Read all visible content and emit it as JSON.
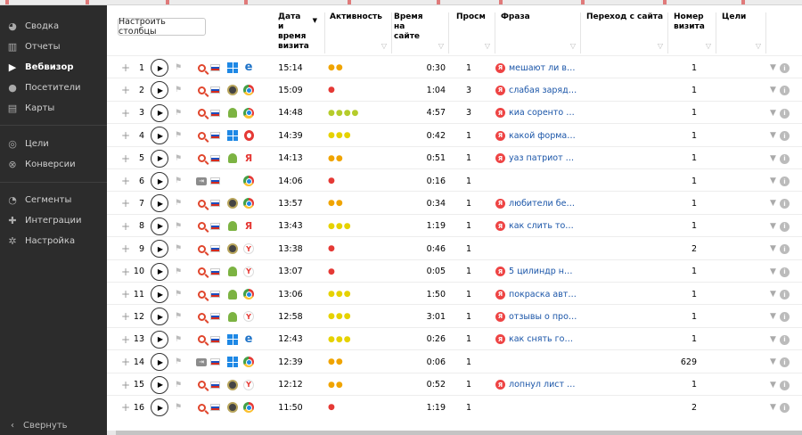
{
  "sidebar": {
    "items": [
      {
        "label": "Сводка",
        "icon": "dashboard-icon",
        "active": false
      },
      {
        "label": "Отчеты",
        "icon": "reports-icon",
        "active": false
      },
      {
        "label": "Вебвизор",
        "icon": "play-icon",
        "active": true
      },
      {
        "label": "Посетители",
        "icon": "user-icon",
        "active": false
      },
      {
        "label": "Карты",
        "icon": "map-icon",
        "active": false
      },
      {
        "label": "Цели",
        "icon": "target-icon",
        "active": false
      },
      {
        "label": "Конверсии",
        "icon": "conversion-icon",
        "active": false
      },
      {
        "label": "Сегменты",
        "icon": "pie-icon",
        "active": false
      },
      {
        "label": "Интеграции",
        "icon": "puzzle-icon",
        "active": false
      },
      {
        "label": "Настройка",
        "icon": "gear-icon",
        "active": false
      }
    ],
    "collapse_label": "Свернуть"
  },
  "toolbar": {
    "configure_columns": "Настроить столбцы"
  },
  "columns": {
    "datetime": "Дата и время визита",
    "activity": "Активность",
    "duration": "Время на сайте",
    "pageviews": "Просм",
    "phrase": "Фраза",
    "referrer": "Переход с сайта",
    "visit_number": "Номер визита",
    "goals": "Цели"
  },
  "colors": {
    "accent_red": "#e53935",
    "link": "#1a55a8",
    "sidebar_bg": "#2c2c2c"
  },
  "rows": [
    {
      "n": "1",
      "src": "search",
      "os": "windows",
      "browser": "edge",
      "time": "15:14",
      "activity": [
        {
          "c": "o",
          "k": 2
        }
      ],
      "duration": "0:30",
      "pv": "1",
      "phrase": "мешают ли вайтв...",
      "visit": "1"
    },
    {
      "n": "2",
      "src": "search",
      "os": "mac",
      "browser": "chrome",
      "time": "15:09",
      "activity": [
        {
          "c": "r",
          "k": 1
        }
      ],
      "duration": "1:04",
      "pv": "3",
      "phrase": "слабая зарядка у...",
      "visit": "1"
    },
    {
      "n": "3",
      "src": "search",
      "os": "android",
      "browser": "chrome",
      "time": "14:48",
      "activity": [
        {
          "c": "g",
          "k": 4
        }
      ],
      "duration": "4:57",
      "pv": "3",
      "phrase": "киа соренто 1 по...",
      "visit": "1"
    },
    {
      "n": "4",
      "src": "search",
      "os": "windows",
      "browser": "opera",
      "time": "14:39",
      "activity": [
        {
          "c": "y",
          "k": 3
        }
      ],
      "duration": "0:42",
      "pv": "1",
      "phrase": "какой формат фл...",
      "visit": "1"
    },
    {
      "n": "5",
      "src": "search",
      "os": "android",
      "browser": "yabrowser",
      "time": "14:13",
      "activity": [
        {
          "c": "o",
          "k": 2
        }
      ],
      "duration": "0:51",
      "pv": "1",
      "phrase": "уаз патриот пери...",
      "visit": "1"
    },
    {
      "n": "6",
      "src": "link",
      "os": "",
      "browser": "chrome",
      "time": "14:06",
      "activity": [
        {
          "c": "r",
          "k": 1
        }
      ],
      "duration": "0:16",
      "pv": "1",
      "phrase": "",
      "visit": "1"
    },
    {
      "n": "7",
      "src": "search",
      "os": "mac",
      "browser": "chrome",
      "time": "13:57",
      "activity": [
        {
          "c": "o",
          "k": 2
        }
      ],
      "duration": "0:34",
      "pv": "1",
      "phrase": "любители бездо...",
      "visit": "1"
    },
    {
      "n": "8",
      "src": "search",
      "os": "android",
      "browser": "yabrowser",
      "time": "13:43",
      "activity": [
        {
          "c": "y",
          "k": 3
        }
      ],
      "duration": "1:19",
      "pv": "1",
      "phrase": "как слить топлив...",
      "visit": "1"
    },
    {
      "n": "9",
      "src": "search",
      "os": "mac",
      "browser": "ya",
      "time": "13:38",
      "activity": [
        {
          "c": "r",
          "k": 1
        }
      ],
      "duration": "0:46",
      "pv": "1",
      "phrase": "",
      "visit": "2"
    },
    {
      "n": "10",
      "src": "search",
      "os": "android",
      "browser": "ya",
      "time": "13:07",
      "activity": [
        {
          "c": "r",
          "k": 1
        }
      ],
      "duration": "0:05",
      "pv": "1",
      "phrase": "5 цилиндр на той...",
      "visit": "1"
    },
    {
      "n": "11",
      "src": "search",
      "os": "android",
      "browser": "chrome",
      "time": "13:06",
      "activity": [
        {
          "c": "y",
          "k": 3
        }
      ],
      "duration": "1:50",
      "pv": "1",
      "phrase": "покраска авто мо...",
      "visit": "1"
    },
    {
      "n": "12",
      "src": "search",
      "os": "android",
      "browser": "ya",
      "time": "12:58",
      "activity": [
        {
          "c": "y",
          "k": 3
        }
      ],
      "duration": "3:01",
      "pv": "1",
      "phrase": "отзывы о продук...",
      "visit": "1"
    },
    {
      "n": "13",
      "src": "search",
      "os": "windows",
      "browser": "edge",
      "time": "12:43",
      "activity": [
        {
          "c": "y",
          "k": 3
        }
      ],
      "duration": "0:26",
      "pv": "1",
      "phrase": "как снять головн...",
      "visit": "1"
    },
    {
      "n": "14",
      "src": "link",
      "os": "windows",
      "browser": "chrome",
      "time": "12:39",
      "activity": [
        {
          "c": "o",
          "k": 2
        }
      ],
      "duration": "0:06",
      "pv": "1",
      "phrase": "",
      "visit": "629"
    },
    {
      "n": "15",
      "src": "search",
      "os": "mac",
      "browser": "ya",
      "time": "12:12",
      "activity": [
        {
          "c": "o",
          "k": 2
        }
      ],
      "duration": "0:52",
      "pv": "1",
      "phrase": "лопнул лист ресс...",
      "visit": "1"
    },
    {
      "n": "16",
      "src": "search",
      "os": "mac",
      "browser": "chrome",
      "time": "11:50",
      "activity": [
        {
          "c": "r",
          "k": 1
        }
      ],
      "duration": "1:19",
      "pv": "1",
      "phrase": "",
      "visit": "2"
    }
  ]
}
